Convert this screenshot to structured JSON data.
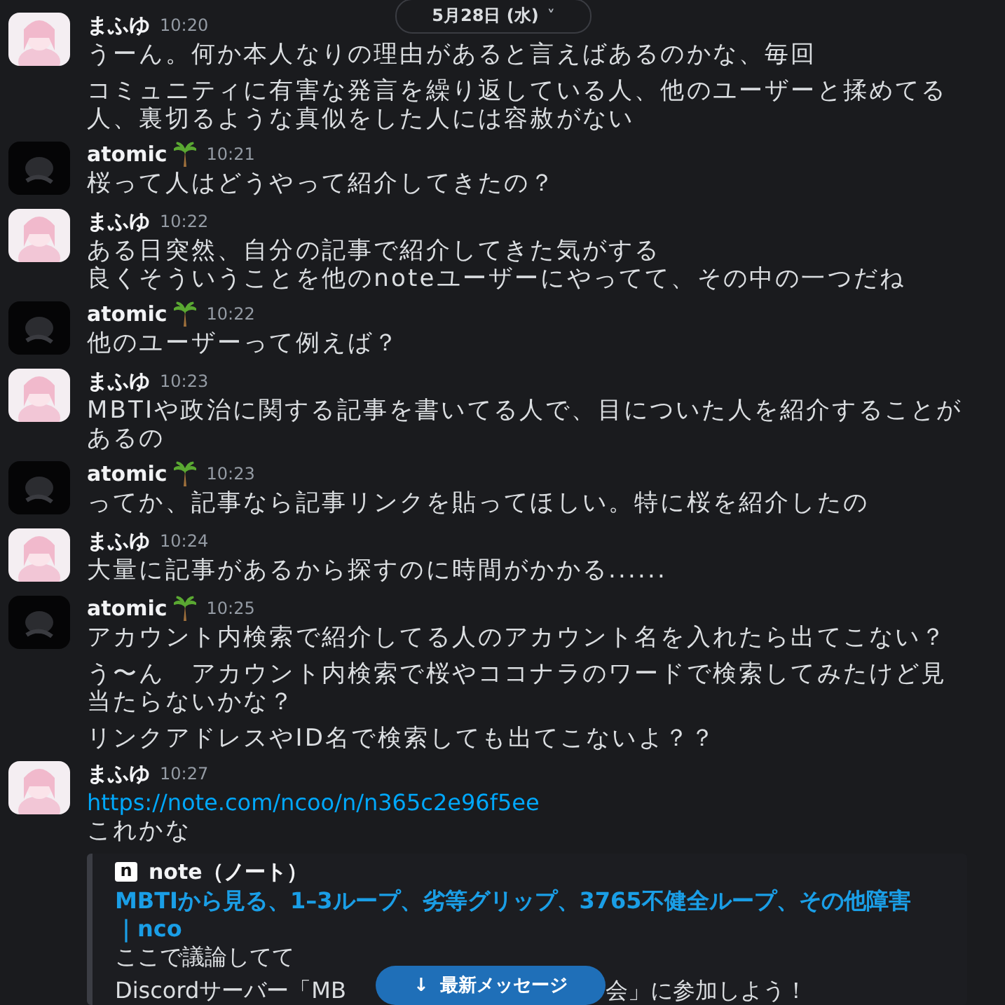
{
  "date_divider": {
    "label": "5月28日 (水)",
    "chevron": "˅"
  },
  "messages": [
    {
      "author": "まふゆ",
      "avatar": {
        "kind": "pink"
      },
      "badge": false,
      "time": "10:20",
      "paragraphs": [
        [
          "うーん。何か本人なりの理由があると言えばあるのかな、毎回"
        ],
        [
          "コミュニティに有害な発言を繰り返している人、他のユーザーと揉めてる人、裏切るような真似をした人には容赦がない"
        ]
      ]
    },
    {
      "author": "atomic",
      "avatar": {
        "kind": "dark"
      },
      "badge": true,
      "time": "10:21",
      "paragraphs": [
        [
          "桜って人はどうやって紹介してきたの？"
        ]
      ]
    },
    {
      "author": "まふゆ",
      "avatar": {
        "kind": "pink"
      },
      "badge": false,
      "time": "10:22",
      "paragraphs": [
        [
          "ある日突然、自分の記事で紹介してきた気がする",
          "良くそういうことを他のnoteユーザーにやってて、その中の一つだね"
        ]
      ]
    },
    {
      "author": "atomic",
      "avatar": {
        "kind": "dark"
      },
      "badge": true,
      "time": "10:22",
      "paragraphs": [
        [
          "他のユーザーって例えば？"
        ]
      ]
    },
    {
      "author": "まふゆ",
      "avatar": {
        "kind": "pink"
      },
      "badge": false,
      "time": "10:23",
      "paragraphs": [
        [
          "MBTIや政治に関する記事を書いてる人で、目についた人を紹介することがあるの"
        ]
      ]
    },
    {
      "author": "atomic",
      "avatar": {
        "kind": "dark"
      },
      "badge": true,
      "time": "10:23",
      "paragraphs": [
        [
          "ってか、記事なら記事リンクを貼ってほしい。特に桜を紹介したの"
        ]
      ]
    },
    {
      "author": "まふゆ",
      "avatar": {
        "kind": "pink"
      },
      "badge": false,
      "time": "10:24",
      "paragraphs": [
        [
          "大量に記事があるから探すのに時間がかかる......"
        ]
      ]
    },
    {
      "author": "atomic",
      "avatar": {
        "kind": "dark"
      },
      "badge": true,
      "time": "10:25",
      "paragraphs": [
        [
          "アカウント内検索で紹介してる人のアカウント名を入れたら出てこない？"
        ],
        [
          "う〜ん　アカウント内検索で桜やココナラのワードで検索してみたけど見当たらないかな？"
        ],
        [
          "リンクアドレスやID名で検索しても出てこないよ？？"
        ]
      ]
    },
    {
      "author": "まふゆ",
      "avatar": {
        "kind": "pink"
      },
      "badge": false,
      "time": "10:27",
      "link": "https://note.com/ncoo/n/n365c2e96f5ee",
      "paragraphs": [
        [
          "これかな"
        ]
      ],
      "embed": {
        "provider_icon": "n",
        "provider": "note（ノート）",
        "title": "MBTIから見る、1–3ループ、劣等グリップ、3765不健全ループ、その他障害｜nco",
        "description": "ここで議論してて",
        "description_2_start": "Discordサーバー「MB",
        "description_2_end": "会」に参加しよう！"
      }
    }
  ],
  "jump_button": {
    "arrow": "↓",
    "label": "最新メッセージ"
  }
}
